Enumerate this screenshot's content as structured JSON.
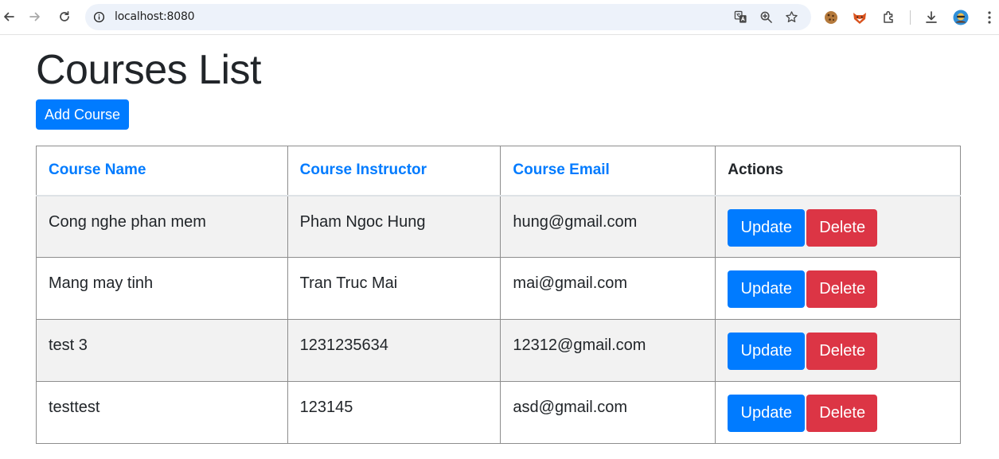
{
  "browser": {
    "url": "localhost:8080",
    "icons": [
      "back-arrow-icon",
      "forward-arrow-icon",
      "reload-icon",
      "site-info-icon",
      "translate-icon",
      "zoom-icon",
      "bookmark-star-icon",
      "cookie-extension-icon",
      "fox-extension-icon",
      "extensions-puzzle-icon",
      "download-icon",
      "profile-avatar-icon",
      "more-menu-icon"
    ]
  },
  "page": {
    "title": "Courses List",
    "add_button_label": "Add Course"
  },
  "table": {
    "headers": {
      "name": "Course Name",
      "instructor": "Course Instructor",
      "email": "Course Email",
      "actions": "Actions"
    },
    "rows": [
      {
        "name": "Cong nghe phan mem",
        "instructor": "Pham Ngoc Hung",
        "email": "hung@gmail.com"
      },
      {
        "name": "Mang may tinh",
        "instructor": "Tran Truc Mai",
        "email": "mai@gmail.com"
      },
      {
        "name": "test 3",
        "instructor": "1231235634",
        "email": "12312@gmail.com"
      },
      {
        "name": "testtest",
        "instructor": "123145",
        "email": "asd@gmail.com"
      }
    ],
    "update_label": "Update",
    "delete_label": "Delete"
  },
  "colors": {
    "primary": "#007bff",
    "danger": "#dc3545",
    "stripe": "#f2f2f2",
    "text": "#212529"
  }
}
